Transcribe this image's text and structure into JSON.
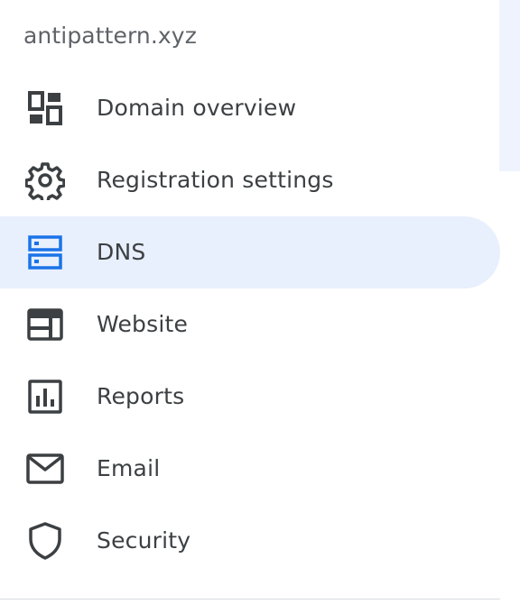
{
  "domain": "antipattern.xyz",
  "nav": {
    "items": [
      {
        "label": "Domain overview",
        "icon": "dashboard-icon",
        "active": false
      },
      {
        "label": "Registration settings",
        "icon": "gear-icon",
        "active": false
      },
      {
        "label": "DNS",
        "icon": "dns-server-icon",
        "active": true
      },
      {
        "label": "Website",
        "icon": "web-browser-icon",
        "active": false
      },
      {
        "label": "Reports",
        "icon": "bar-chart-icon",
        "active": false
      },
      {
        "label": "Email",
        "icon": "mail-icon",
        "active": false
      },
      {
        "label": "Security",
        "icon": "shield-icon",
        "active": false
      }
    ]
  },
  "colors": {
    "icon_default": "#3c4043",
    "icon_active": "#1a73e8",
    "active_bg": "#e8effd",
    "label": "#3c4043",
    "domain_text": "#5f6368"
  }
}
